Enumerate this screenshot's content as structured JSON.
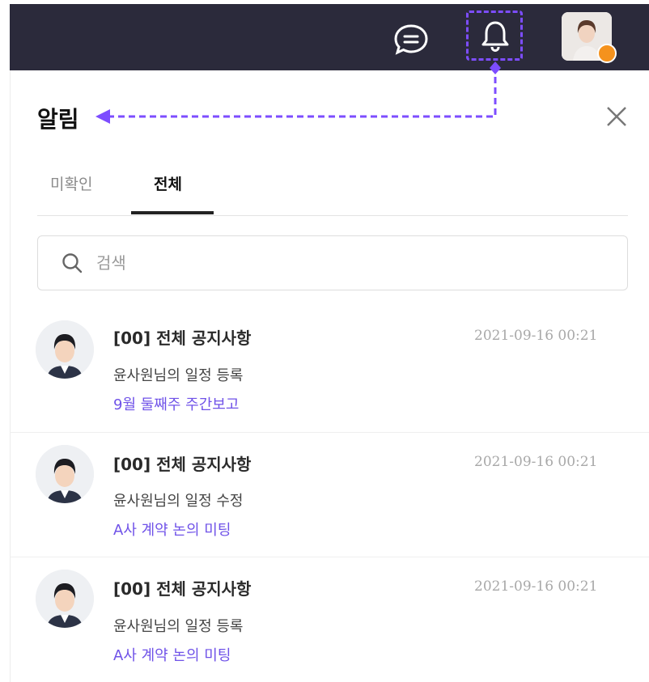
{
  "panel": {
    "title": "알림",
    "tabs": [
      {
        "label": "미확인",
        "active": false
      },
      {
        "label": "전체",
        "active": true
      }
    ],
    "search": {
      "placeholder": "검색",
      "value": ""
    }
  },
  "header": {
    "icons": [
      "chat-icon",
      "bell-icon",
      "user-avatar"
    ],
    "status_color": "#f5921d"
  },
  "accent_color": "#7d4dff",
  "notifications": [
    {
      "title": "[00] 전체 공지사항",
      "time": "2021-09-16 00:21",
      "desc": "윤사원님의 일정 등록",
      "sub": "9월 둘째주 주간보고"
    },
    {
      "title": "[00] 전체 공지사항",
      "time": "2021-09-16 00:21",
      "desc": "윤사원님의 일정 수정",
      "sub": "A사 계약 논의 미팅"
    },
    {
      "title": "[00] 전체 공지사항",
      "time": "2021-09-16 00:21",
      "desc": "윤사원님의 일정 등록",
      "sub": "A사 계약 논의 미팅"
    }
  ]
}
